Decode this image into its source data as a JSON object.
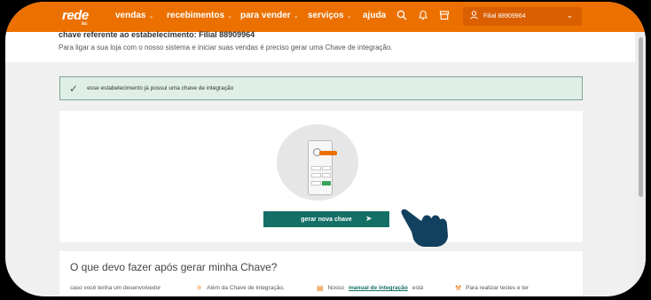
{
  "nav": {
    "logo": "rede",
    "logo_sub": "itaú",
    "items": [
      "vendas",
      "recebimentos",
      "para vender",
      "serviços",
      "ajuda"
    ],
    "account_label": "Filial 88909964"
  },
  "header": {
    "title": "chave referente ao estabelecimento: Filial 88909964",
    "description": "Para ligar a sua loja com o nosso sistema e iniciar suas vendas é preciso gerar uma Chave de integração."
  },
  "alert": {
    "message": "esse estabelecimento já possui uma chave de integração"
  },
  "card": {
    "button_label": "gerar nova chave"
  },
  "section": {
    "title": "O que devo fazer após gerar minha Chave?",
    "col1": "caso você tenha um desenvolvedor",
    "col2": "Além da Chave de integração,",
    "col3_prefix": "Nosso",
    "col3_link": "manual de integração",
    "col3_suffix": "está",
    "col4": "Para realizar testes e ter"
  },
  "colors": {
    "brand": "#ec7000",
    "teal": "#146f66",
    "alert_bg": "#dfeee6"
  },
  "icons": [
    "search-icon",
    "bell-icon",
    "store-icon",
    "user-icon",
    "chevron-down-icon",
    "check-icon",
    "cursor-icon",
    "pointing-hand-icon"
  ]
}
